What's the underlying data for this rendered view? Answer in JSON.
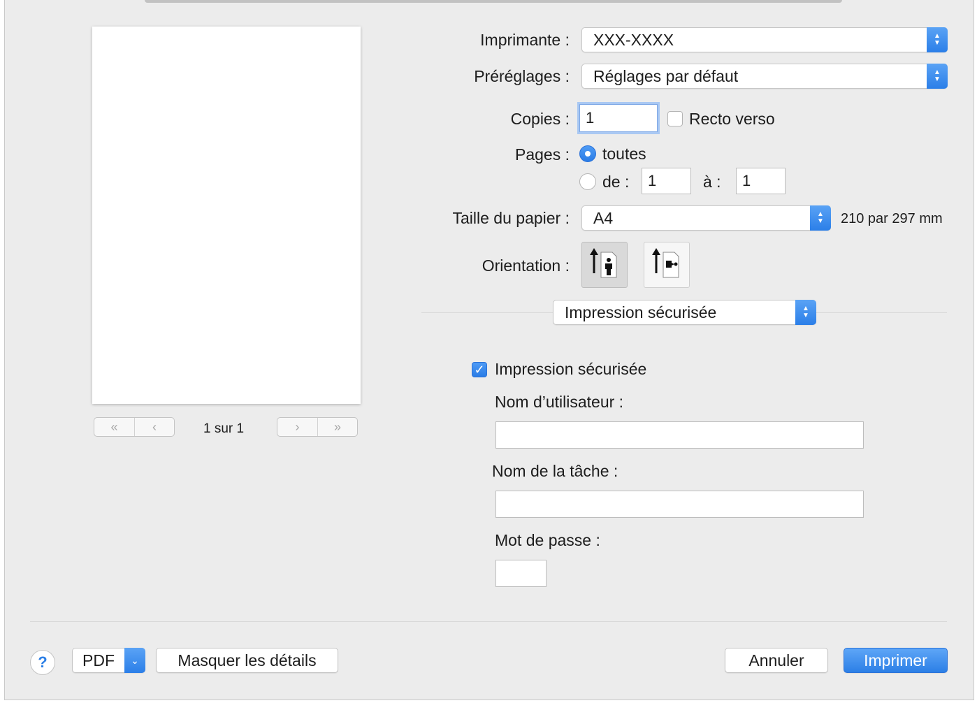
{
  "labels": {
    "printer": "Imprimante :",
    "presets": "Préréglages :",
    "copies": "Copies :",
    "pages": "Pages :",
    "paper_size": "Taille du papier :",
    "orientation": "Orientation :"
  },
  "printer": {
    "value": "XXX-XXXX"
  },
  "presets": {
    "value": "Réglages par défaut"
  },
  "copies": {
    "value": "1"
  },
  "duplex": {
    "label": "Recto verso",
    "checked": false
  },
  "pages": {
    "all_label": "toutes",
    "range_label": "de :",
    "to_label": "à :",
    "from_value": "1",
    "to_value": "1",
    "selected": "all"
  },
  "paper_size": {
    "value": "A4",
    "dimensions": "210 par 297 mm"
  },
  "orientation": {
    "selected": "portrait",
    "icons": [
      "portrait-icon",
      "landscape-icon"
    ]
  },
  "section_menu": {
    "value": "Impression sécurisée"
  },
  "secure_print": {
    "checkbox_label": "Impression sécurisée",
    "checked": true,
    "username_label": "Nom d’utilisateur :",
    "username_value": "",
    "jobname_label": "Nom de la tâche :",
    "jobname_value": "",
    "password_label": "Mot de passe :",
    "password_value": ""
  },
  "preview": {
    "page_info": "1 sur 1",
    "nav_icons": [
      "first-page-icon",
      "previous-page-icon",
      "next-page-icon",
      "last-page-icon"
    ]
  },
  "footer": {
    "help": "?",
    "pdf": "PDF",
    "hide_details": "Masquer les détails",
    "cancel": "Annuler",
    "print": "Imprimer"
  },
  "colors": {
    "accent": "#2c7fe6",
    "background": "#ececec"
  }
}
